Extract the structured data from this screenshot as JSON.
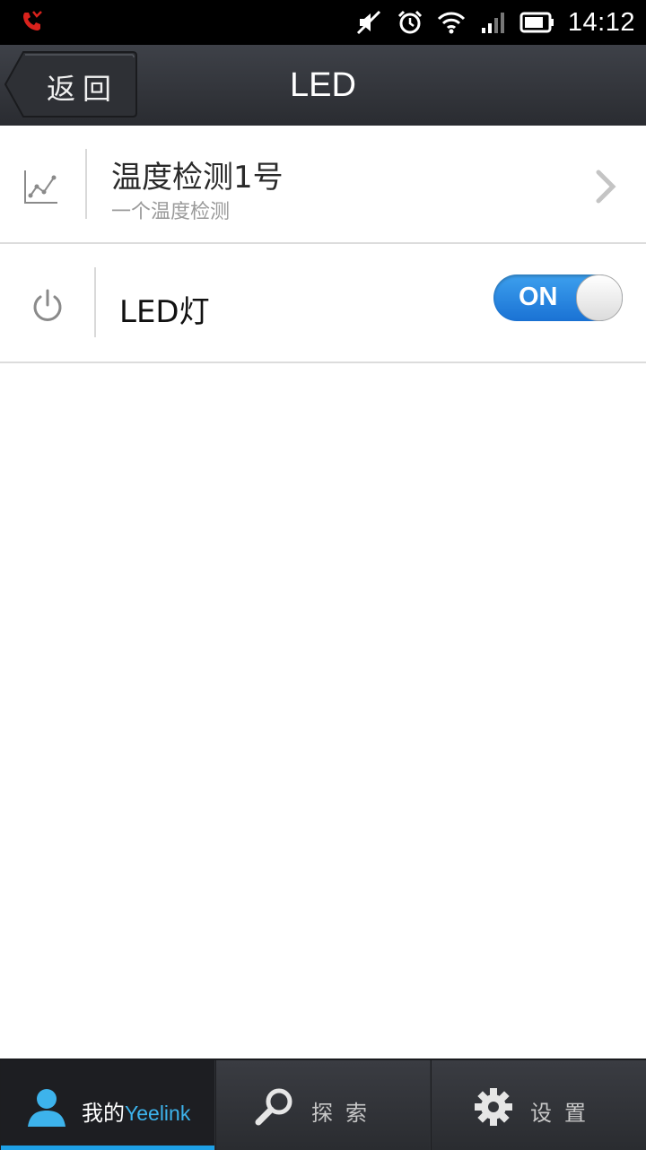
{
  "status_bar": {
    "time": "14:12",
    "icons": [
      "missed-call-icon",
      "mute-icon",
      "alarm-icon",
      "wifi-icon",
      "signal-icon",
      "battery-icon"
    ],
    "accent": "#d9221c"
  },
  "header": {
    "back_label": "返回",
    "title": "LED"
  },
  "list": [
    {
      "icon": "line-chart-icon",
      "title": "温度检测1号",
      "subtitle": "一个温度检测",
      "trailing": "chevron-right-icon"
    },
    {
      "icon": "power-icon",
      "title": "LED灯",
      "toggle": {
        "label": "ON",
        "state": true,
        "color": "#1f80de"
      }
    }
  ],
  "bottom_nav": {
    "tabs": [
      {
        "label": "我的",
        "label_en": "Yeelink",
        "icon": "user-icon",
        "active": true
      },
      {
        "label": "探索",
        "icon": "search-icon",
        "active": false
      },
      {
        "label": "设置",
        "icon": "gear-icon",
        "active": false
      }
    ],
    "active_color": "#1ea0e6"
  }
}
